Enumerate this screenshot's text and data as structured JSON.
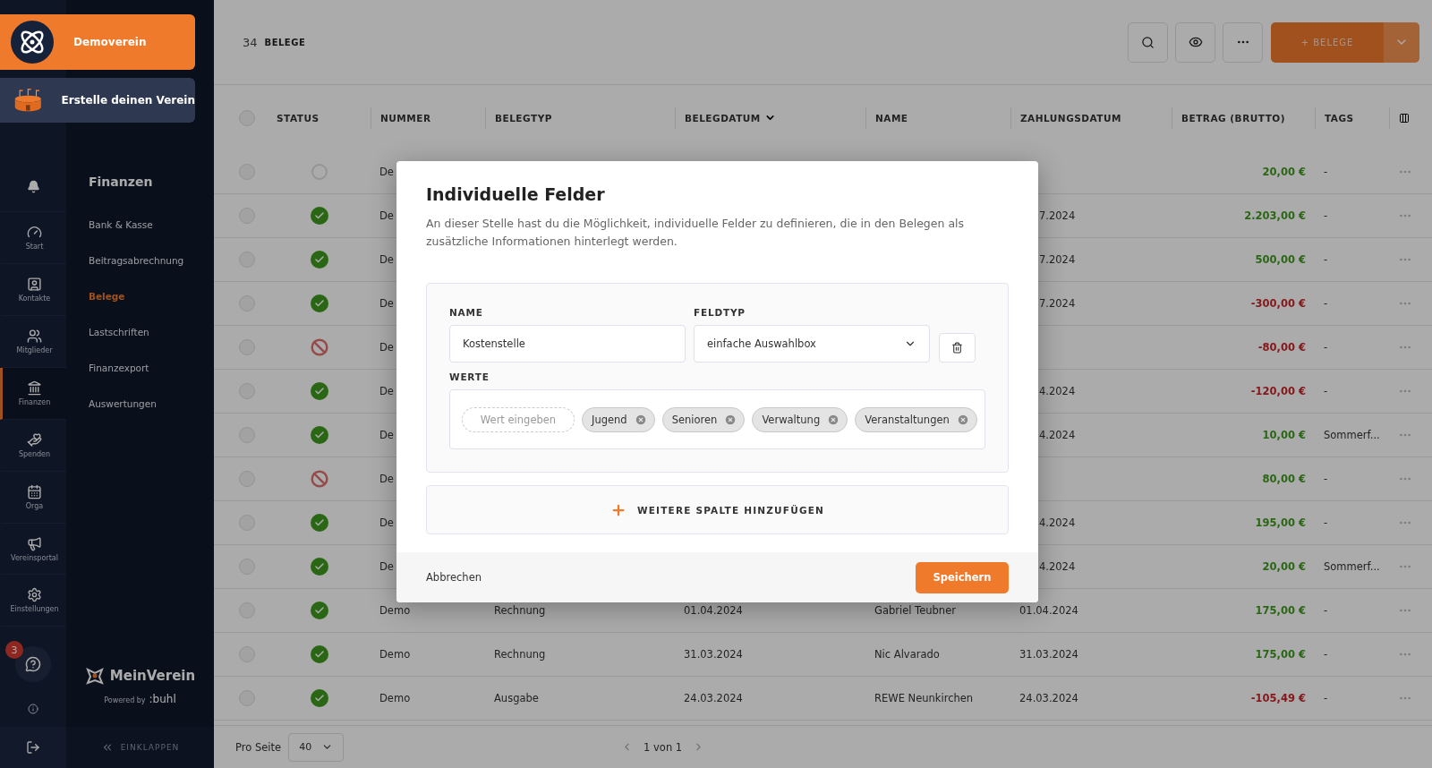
{
  "org": {
    "name": "Demoverein"
  },
  "create_club": {
    "label": "Erstelle deinen Verein"
  },
  "rail": [
    {
      "label": "Start",
      "selected": false
    },
    {
      "label": "Kontakte",
      "selected": false
    },
    {
      "label": "Mitglieder",
      "selected": false
    },
    {
      "label": "Finanzen",
      "selected": true
    },
    {
      "label": "Spenden",
      "selected": false
    },
    {
      "label": "Orga",
      "selected": false
    },
    {
      "label": "Vereinsportal",
      "selected": false
    },
    {
      "label": "Einstellungen",
      "selected": false
    }
  ],
  "help": {
    "badge": "3"
  },
  "subnav": {
    "title": "Finanzen",
    "items": [
      {
        "label": "Bank & Kasse",
        "selected": false
      },
      {
        "label": "Beitragsabrechnung",
        "selected": false
      },
      {
        "label": "Belege",
        "selected": true
      },
      {
        "label": "Lastschriften",
        "selected": false
      },
      {
        "label": "Finanzexport",
        "selected": false
      },
      {
        "label": "Auswertungen",
        "selected": false
      }
    ]
  },
  "brand": {
    "name": "MeinVerein",
    "powered_by": "Powered by",
    "partner": ":buhl"
  },
  "collapse": {
    "label": "EINKLAPPEN"
  },
  "header": {
    "count": "34",
    "title": "BELEGE",
    "add_button": "+ BELEGE"
  },
  "table": {
    "select_all": {
      "selected": false
    },
    "columns": [
      {
        "label": "STATUS",
        "sorted": false
      },
      {
        "label": "NUMMER",
        "sorted": false
      },
      {
        "label": "BELEGTYP",
        "sorted": false
      },
      {
        "label": "BELEGDATUM",
        "sorted": true
      },
      {
        "label": "NAME",
        "sorted": false
      },
      {
        "label": "ZAHLUNGSDATUM",
        "sorted": false
      },
      {
        "label": "BETRAG (BRUTTO)",
        "sorted": false
      },
      {
        "label": "TAGS",
        "sorted": false
      }
    ],
    "rows": [
      {
        "selected": false,
        "kind": "open",
        "nummer": "De",
        "betrag": "20,00 €",
        "negative": false,
        "tags": "-"
      },
      {
        "selected": false,
        "kind": "paid",
        "nummer": "De",
        "zahlungsdatum": "7.2024",
        "betrag": "2.203,00 €",
        "negative": false,
        "tags": "-"
      },
      {
        "selected": false,
        "kind": "paid",
        "nummer": "De",
        "zahlungsdatum": "7.2024",
        "betrag": "500,00 €",
        "negative": false,
        "tags": "-"
      },
      {
        "selected": false,
        "kind": "paid",
        "nummer": "De",
        "zahlungsdatum": "7.2024",
        "betrag": "-300,00 €",
        "negative": true,
        "tags": "-"
      },
      {
        "selected": false,
        "kind": "cancelled",
        "nummer": "De",
        "betrag": "-80,00 €",
        "negative": true,
        "tags": "-"
      },
      {
        "selected": false,
        "kind": "paid",
        "nummer": "De",
        "zahlungsdatum": "4.2024",
        "betrag": "-120,00 €",
        "negative": true,
        "tags": "-"
      },
      {
        "selected": false,
        "kind": "paid",
        "nummer": "De",
        "zahlungsdatum": "4.2024",
        "betrag": "10,00 €",
        "negative": false,
        "tags": "Sommerf..."
      },
      {
        "selected": false,
        "kind": "cancelled",
        "nummer": "De",
        "betrag": "80,00 €",
        "negative": false,
        "tags": "-"
      },
      {
        "selected": false,
        "kind": "paid",
        "nummer": "De",
        "zahlungsdatum": "4.2024",
        "betrag": "195,00 €",
        "negative": false,
        "tags": "-"
      },
      {
        "selected": false,
        "kind": "paid",
        "nummer": "De",
        "zahlungsdatum": "4.2024",
        "betrag": "20,00 €",
        "negative": false,
        "tags": "Sommerf..."
      },
      {
        "selected": false,
        "kind": "paid",
        "nummer": "Demo",
        "belegtyp": "Rechnung",
        "belegdatum": "01.04.2024",
        "name": "Gabriel Teubner",
        "zahlungsdatum": "01.04.2024",
        "betrag": "175,00 €",
        "negative": false,
        "tags": "-"
      },
      {
        "selected": false,
        "kind": "paid",
        "nummer": "Demo",
        "belegtyp": "Rechnung",
        "belegdatum": "31.03.2024",
        "name": "Nic Alvarado",
        "zahlungsdatum": "31.03.2024",
        "betrag": "175,00 €",
        "negative": false,
        "tags": "-"
      },
      {
        "selected": false,
        "kind": "paid",
        "nummer": "Demo",
        "belegtyp": "Ausgabe",
        "belegdatum": "24.03.2024",
        "name": "REWE Neunkirchen",
        "zahlungsdatum": "24.03.2024",
        "betrag": "-105,49 €",
        "negative": true,
        "tags": "-"
      }
    ]
  },
  "pagination": {
    "per_page_label": "Pro Seite",
    "per_page": "40",
    "page": "1 von 1"
  },
  "dialog": {
    "title": "Individuelle Felder",
    "description": "An dieser Stelle hast du die Möglichkeit, individuelle Felder zu definieren, die in den Belegen als zusätzliche Informationen hinterlegt werden.",
    "name_label": "NAME",
    "name_value": "Kostenstelle",
    "type_label": "FELDTYP",
    "type_value": "einfache Auswahlbox",
    "values_label": "WERTE",
    "value_placeholder": "Wert eingeben",
    "values": [
      "Jugend",
      "Senioren",
      "Verwaltung",
      "Veranstaltungen"
    ],
    "add_column": "WEITERE SPALTE HINZUFÜGEN",
    "cancel": "Abbrechen",
    "save": "Speichern"
  }
}
